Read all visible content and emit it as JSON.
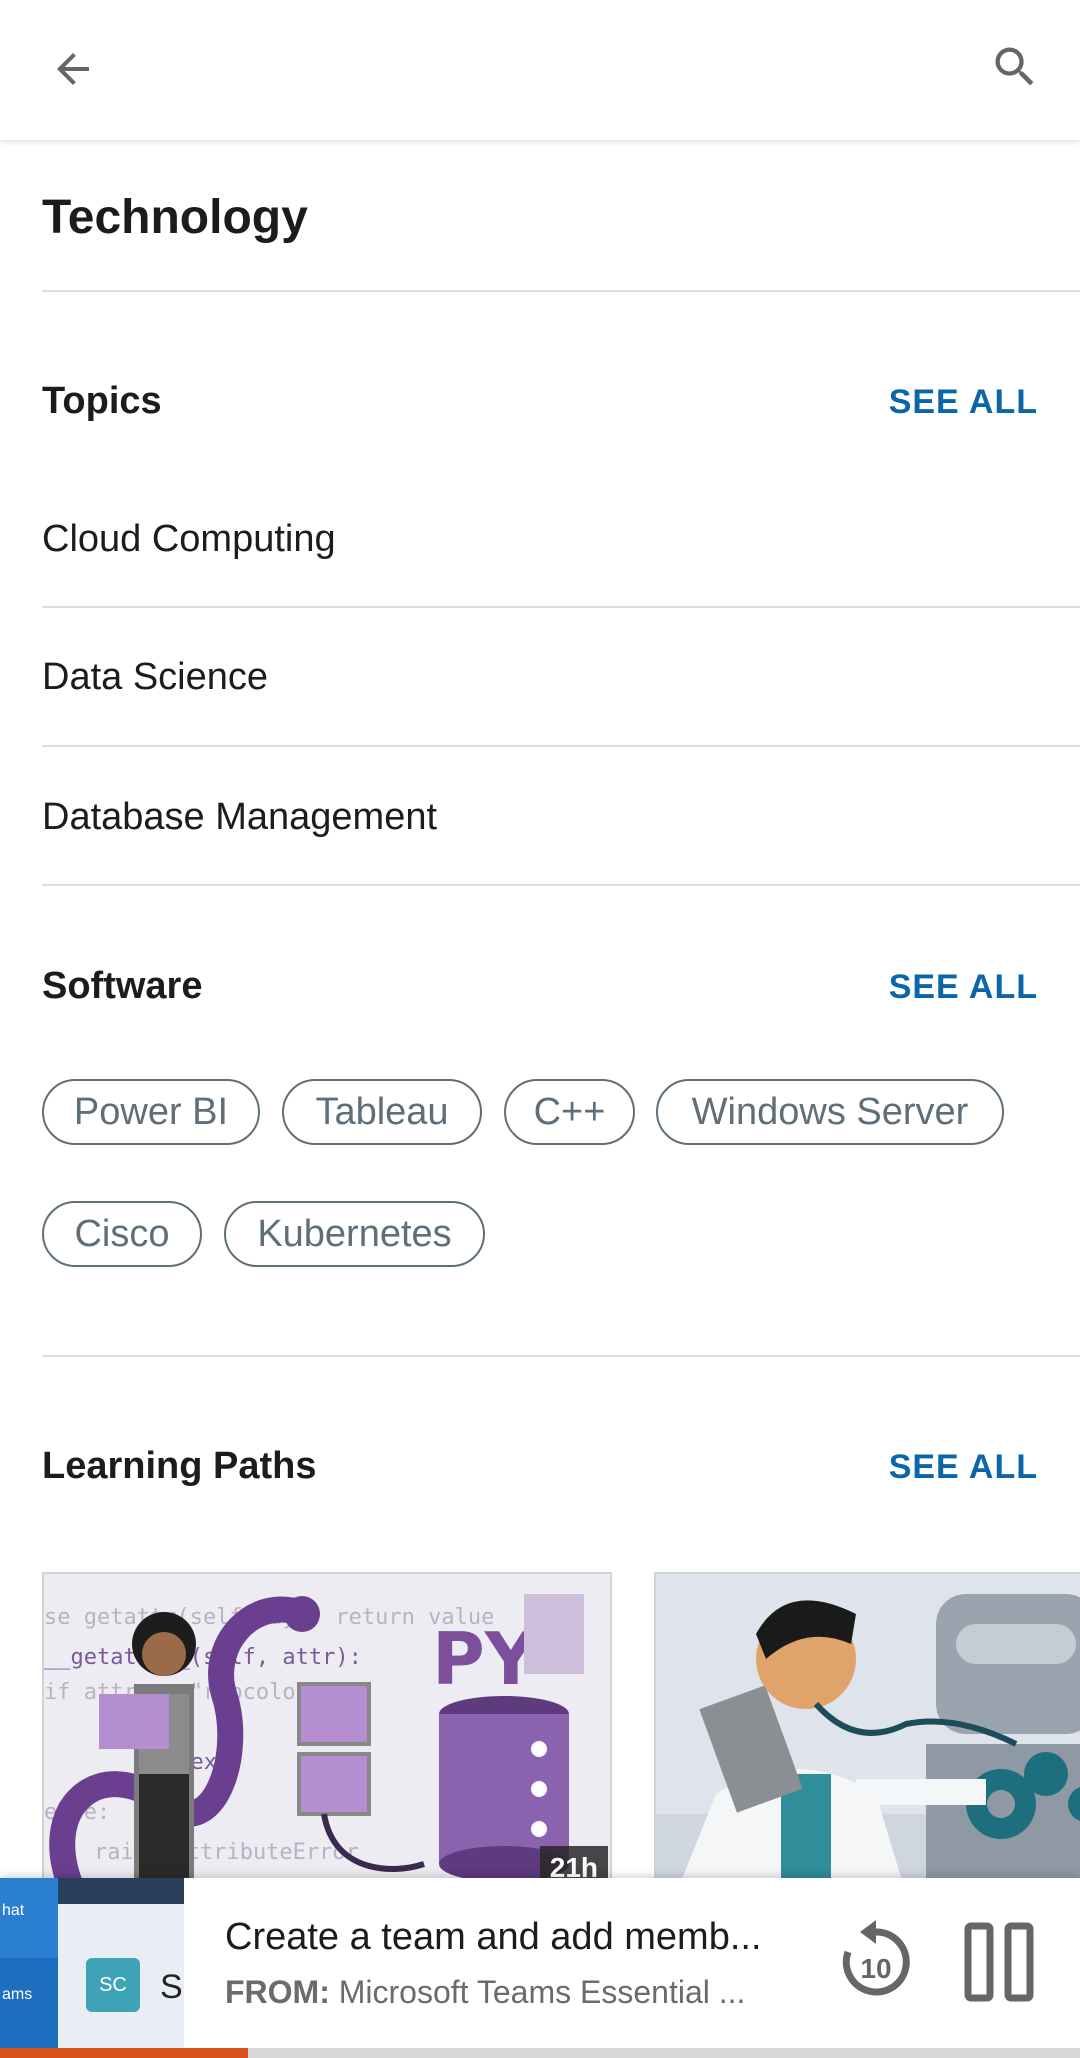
{
  "page_title": "Technology",
  "topics": {
    "title": "Topics",
    "see_all": "SEE ALL",
    "items": [
      "Cloud Computing",
      "Data Science",
      "Database Management"
    ]
  },
  "software": {
    "title": "Software",
    "see_all": "SEE ALL",
    "chips": [
      "Power BI",
      "Tableau",
      "C++",
      "Windows Server",
      "Cisco",
      "Kubernetes"
    ]
  },
  "learning_paths": {
    "title": "Learning Paths",
    "see_all": "SEE ALL",
    "cards": [
      {
        "duration_badge": "21h",
        "illustration": "python-snake-database"
      },
      {
        "illustration": "doctor-robot"
      }
    ]
  },
  "mini_player": {
    "title": "Create a team and add memb...",
    "from_label": "FROM:",
    "source": "Microsoft Teams Essential ...",
    "thumb_initials": "SC",
    "thumb_text_chat": "hat",
    "thumb_text_teams": "ams",
    "progress": 0.23
  },
  "colors": {
    "accent": "#0a66a8",
    "chip_border": "#5f6f7a",
    "progress": "#d9531e"
  }
}
